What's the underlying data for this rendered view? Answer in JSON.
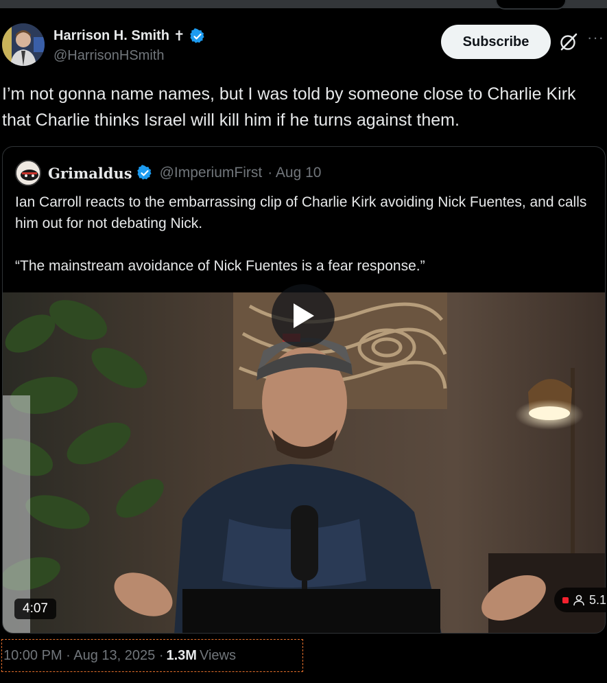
{
  "author": {
    "name": "Harrison H. Smith",
    "handle": "@HarrisonHSmith",
    "cross_glyph": "✝"
  },
  "actions": {
    "subscribe_label": "Subscribe",
    "more_label": "···"
  },
  "tweet": {
    "text": "I’m not gonna name names, but I was told by someone close to Charlie Kirk that Charlie thinks Israel will kill him if he turns against them."
  },
  "quote": {
    "name": "Grimaldus",
    "handle": "@ImperiumFirst",
    "date": "· Aug 10",
    "text": "Ian Carroll reacts to the embarrassing clip of Charlie Kirk avoiding Nick Fuentes, and calls him out for not debating Nick.\n\n“The mainstream avoidance of Nick Fuentes is a fear response.”",
    "video": {
      "duration": "4:07",
      "live_count": "5.1"
    }
  },
  "footer": {
    "time": "10:00 PM · Aug 13, 2025 ·",
    "views_count": "1.3M",
    "views_label": "Views"
  },
  "colors": {
    "background": "#000000",
    "text": "#e7e9ea",
    "muted": "#71767b",
    "verified": "#1d9bf0",
    "subscribe_bg": "#eff3f4",
    "focus_outline": "#e8712b"
  }
}
